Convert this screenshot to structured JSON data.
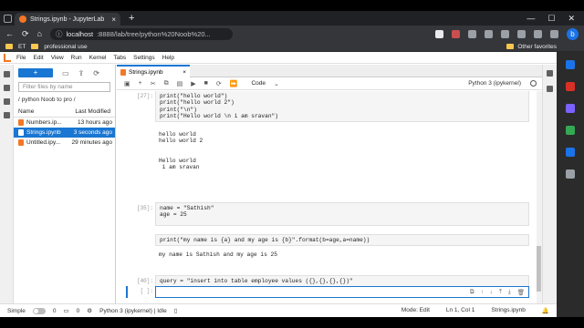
{
  "browser": {
    "tab_title": "Strings.ipynb - JupyterLab",
    "url_host": "localhost",
    "url_rest": ":8888/lab/tree/python%20Noob%20...",
    "bookmarks": [
      "ET",
      "professional use"
    ],
    "other_favorites": "Other favorites",
    "bing_label": "b"
  },
  "menu": [
    "File",
    "Edit",
    "View",
    "Run",
    "Kernel",
    "Tabs",
    "Settings",
    "Help"
  ],
  "filebrowser": {
    "new_label": "+",
    "filter_placeholder": "Filter files by name",
    "breadcrumb": "/ python Noob to pro /",
    "col_name": "Name",
    "col_modified": "Last Modified",
    "files": [
      {
        "name": "Numbers.ip...",
        "modified": "13 hours ago",
        "selected": false
      },
      {
        "name": "Strings.ipynb",
        "modified": "3 seconds ago",
        "selected": true
      },
      {
        "name": "Untitled.ipy...",
        "modified": "29 minutes ago",
        "selected": false
      }
    ]
  },
  "notebook": {
    "tab_name": "Strings.ipynb",
    "cell_type": "Code",
    "kernel": "Python 3 (ipykernel)",
    "cells": [
      {
        "prompt": "[27]:",
        "lines": [
          "print(\"hello world\")",
          "print(\"hello world 2\")",
          "print(\"\\n\")",
          "print(\"Hello world \\n i am sravan\")"
        ]
      },
      {
        "prompt": "",
        "output": [
          "hello world",
          "hello world 2",
          "",
          "",
          "Hello world",
          " i am sravan"
        ]
      },
      {
        "prompt": "[35]:",
        "lines": [
          "name = \"Sathish\"",
          "age = 25"
        ]
      },
      {
        "prompt": "",
        "lines": [
          "print(\"my name is {a} and my age is {b}\".format(b=age,a=name))"
        ]
      },
      {
        "prompt": "",
        "output": [
          "my name is Sathish and my age is 25"
        ]
      },
      {
        "prompt": "[40]:",
        "lines": [
          "query = \"insert into table employee values ({},{},{},{})\""
        ]
      }
    ],
    "active_prompt": "[ ]:"
  },
  "status": {
    "mode_label": "Simple",
    "kernel_status": "Python 3 (ipykernel) | Idle",
    "left_counts": "0",
    "mode": "Mode: Edit",
    "position": "Ln 1, Col 1",
    "file": "Strings.ipynb"
  }
}
